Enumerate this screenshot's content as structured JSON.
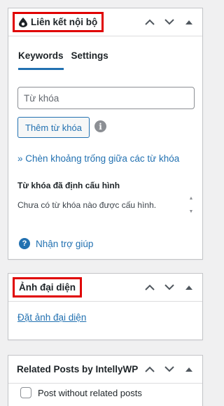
{
  "internal_links": {
    "title": "Liên kết nội bộ",
    "tabs": [
      {
        "label": "Keywords"
      },
      {
        "label": "Settings"
      }
    ],
    "keyword_placeholder": "Từ khóa",
    "add_button": "Thêm từ khóa",
    "space_link": "» Chèn khoảng trống giữa các từ khóa",
    "configured_label": "Từ khóa đã định cấu hình",
    "empty_message": "Chưa có từ khóa nào được cấu hình.",
    "help_link": "Nhận trợ giúp"
  },
  "featured_image": {
    "title": "Ảnh đại diện",
    "set_link": "Đặt ảnh đại diện"
  },
  "related_posts": {
    "title": "Related Posts by IntellyWP",
    "checkbox_label": "Post without related posts"
  },
  "colors": {
    "highlight_border": "#e00000",
    "accent": "#2271b1",
    "background": "#f0f0f1"
  }
}
